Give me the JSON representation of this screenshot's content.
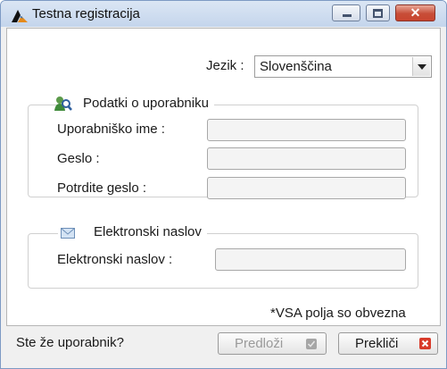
{
  "window": {
    "title": "Testna registracija"
  },
  "language": {
    "label": "Jezik :",
    "selected": "Slovenščina"
  },
  "user_group": {
    "legend": "Podatki o uporabniku",
    "username_label": "Uporabniško ime :",
    "password_label": "Geslo :",
    "confirm_label": "Potrdite geslo :"
  },
  "email_group": {
    "legend": "Elektronski naslov",
    "email_label": "Elektronski naslov :"
  },
  "required_note": "*VSA polja so obvezna",
  "footer": {
    "existing_user": "Ste že uporabnik?",
    "submit_label": "Predloži",
    "cancel_label": "Prekliči"
  },
  "colors": {
    "titlebar": "#c4d5ec",
    "close_red": "#c74d38",
    "cancel_icon": "#d83a2a"
  }
}
